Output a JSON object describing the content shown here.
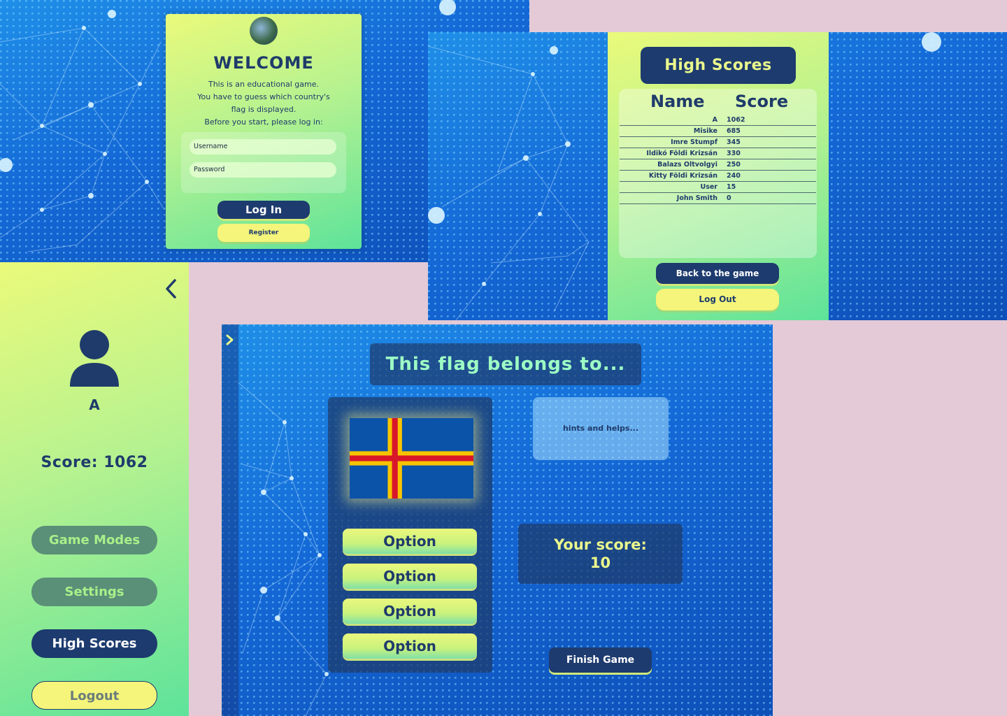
{
  "login": {
    "title": "WELCOME",
    "intro_lines": [
      "This is an educational game.",
      "You have to guess which country's",
      "flag is displayed.",
      "Before you start, please log in:"
    ],
    "username_placeholder": "Username",
    "password_placeholder": "Password",
    "login_label": "Log In",
    "register_label": "Register"
  },
  "high_scores": {
    "title": "High Scores",
    "col_name": "Name",
    "col_score": "Score",
    "rows": [
      {
        "name": "A",
        "score": "1062"
      },
      {
        "name": "Misike",
        "score": "685"
      },
      {
        "name": "Imre Stumpf",
        "score": "345"
      },
      {
        "name": "Ildikó Földi Krizsán",
        "score": "330"
      },
      {
        "name": "Balazs Oltvolgyi",
        "score": "250"
      },
      {
        "name": "Kitty Földi Krizsán",
        "score": "240"
      },
      {
        "name": "User",
        "score": "15"
      },
      {
        "name": "John Smith",
        "score": "0"
      }
    ],
    "back_label": "Back to the game",
    "logout_label": "Log Out"
  },
  "profile": {
    "username": "A",
    "score_text": "Score: 1062",
    "buttons": {
      "game_modes": "Game Modes",
      "settings": "Settings",
      "high_scores": "High Scores",
      "logout": "Logout"
    }
  },
  "game": {
    "question": "This flag belongs to...",
    "hint_text": "hints and helps...",
    "options": [
      "Option",
      "Option",
      "Option",
      "Option"
    ],
    "score_label": "Your score:",
    "score_value": "10",
    "finish_label": "Finish Game"
  },
  "colors": {
    "navy": "#1d3b6e",
    "yellow": "#f4f57a",
    "mint": "#9dfcc4",
    "page_background": "#e4cad6"
  }
}
